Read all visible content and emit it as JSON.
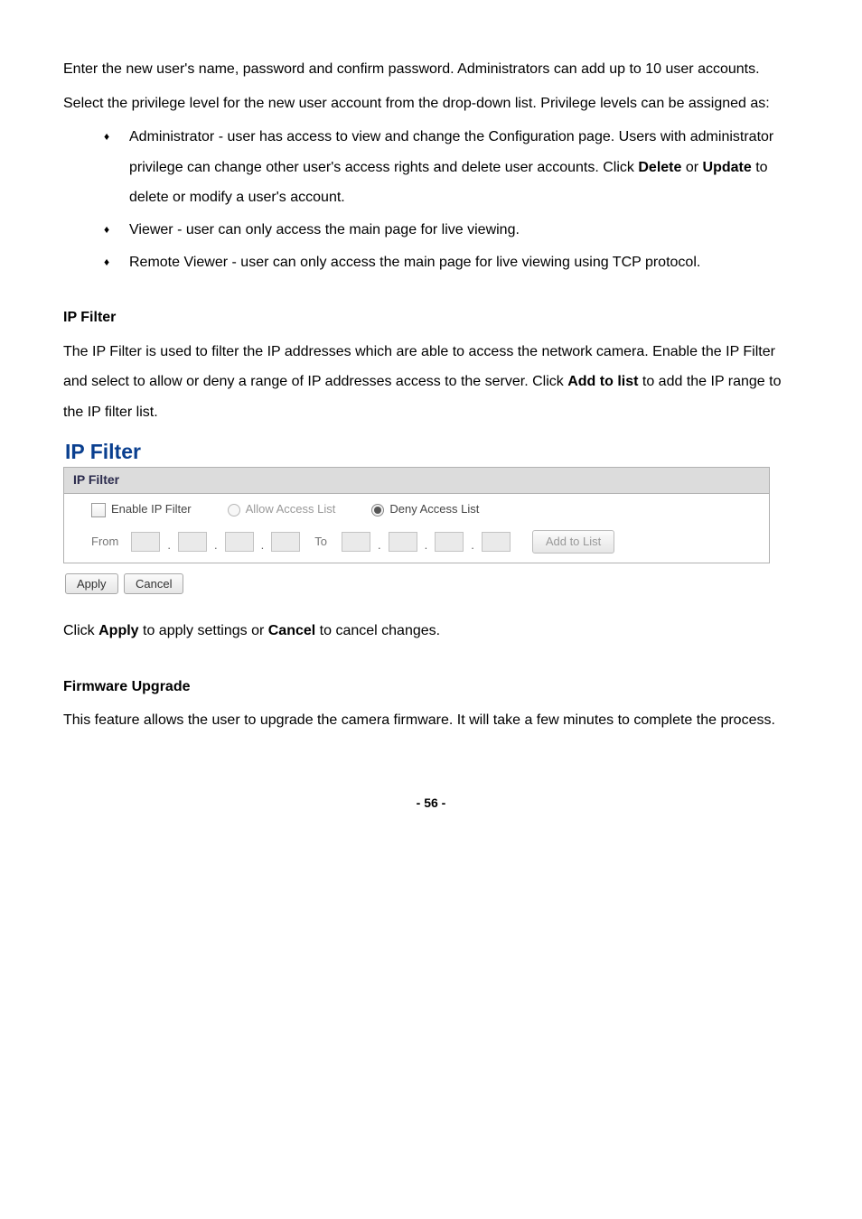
{
  "p1": "Enter the new user's name, password and confirm password. Administrators can add up to 10 user accounts.",
  "p2": "Select the privilege level for the new user account from the drop-down list. Privilege levels can be assigned as:",
  "bullets": {
    "admin_a": "Administrator - user has access to view and change the Configuration page. Users with administrator privilege can change other user's access rights and delete user accounts. Click ",
    "admin_delete": "Delete",
    "admin_or": " or ",
    "admin_update": "Update",
    "admin_b": " to delete or modify a user's account.",
    "viewer": "Viewer - user can only access the main page for live viewing.",
    "remote": "Remote Viewer - user can only access the main page for live viewing using TCP protocol."
  },
  "ipfilter": {
    "heading": "IP Filter",
    "desc_a": "The IP Filter is used to filter the IP addresses which are able to access the network camera. Enable the IP Filter and select to allow or deny a range of IP addresses access to the server. Click ",
    "desc_bold": "Add to list",
    "desc_b": " to add the IP range to the IP filter list.",
    "widget": {
      "title": "IP Filter",
      "panel_header": "IP Filter",
      "enable_label": "Enable IP Filter",
      "allow_label": "Allow Access List",
      "deny_label": "Deny Access List",
      "from_label": "From",
      "to_label": "To",
      "add_btn": "Add to List",
      "apply_btn": "Apply",
      "cancel_btn": "Cancel"
    },
    "footer_a": "Click ",
    "footer_apply": "Apply",
    "footer_mid": " to apply settings or ",
    "footer_cancel": "Cancel",
    "footer_b": " to cancel changes."
  },
  "firmware": {
    "heading": "Firmware Upgrade",
    "desc": "This feature allows the user to upgrade the camera firmware. It will take a few minutes to complete the process."
  },
  "page_num": "- 56 -"
}
